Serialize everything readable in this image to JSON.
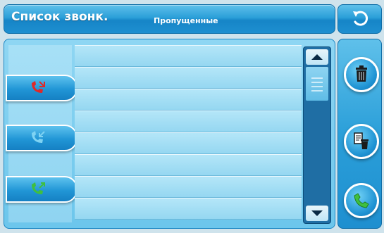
{
  "header": {
    "title": "Список звонк.",
    "subtitle": "Пропущенные"
  },
  "icons": {
    "back": "back-arrow-icon",
    "missed_call": "missed-call-icon",
    "incoming_call": "incoming-call-icon",
    "outgoing_call": "outgoing-call-icon",
    "delete": "trash-icon",
    "delete_all": "delete-all-icon",
    "dial": "phone-handset-icon"
  },
  "colors": {
    "accent": "#1f93d3",
    "missed": "#e02828",
    "incoming": "#49b8e6",
    "outgoing": "#3fbf3f"
  }
}
